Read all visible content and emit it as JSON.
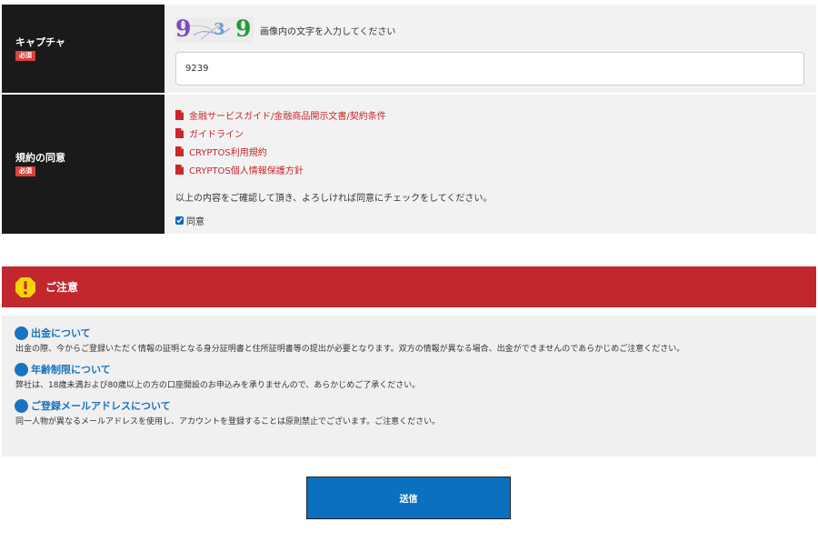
{
  "captcha": {
    "label": "キャプチャ",
    "required_badge": "必須",
    "image_chars": [
      "9",
      "3",
      "9"
    ],
    "image_colors": [
      "#7a4bbf",
      "#6f9bd1",
      "#1f9a3a"
    ],
    "hint": "画像内の文字を入力してください",
    "input_value": "9239"
  },
  "terms": {
    "label": "規約の同意",
    "required_badge": "必須",
    "documents": [
      "金融サービスガイド/金融商品開示文書/契約条件",
      "ガイドライン",
      "CRYPTOS利用規約",
      "CRYPTOS個人情報保護方針"
    ],
    "note": "以上の内容をご確認して頂き、よろしければ同意にチェックをしてください。",
    "agree_label": "同意",
    "agree_checked": true
  },
  "caution": {
    "title": "ご注意",
    "icon": "warning-icon",
    "items": [
      {
        "heading": "出金について",
        "text": "出金の際、今からご登録いただく情報の証明となる身分証明書と住所証明書等の提出が必要となります。双方の情報が異なる場合、出金ができませんのであらかじめご注意ください。"
      },
      {
        "heading": "年齢制限について",
        "text": "弊社は、18歳未満および80歳以上の方の口座開設のお申込みを承りませんので、あらかじめご了承ください。"
      },
      {
        "heading": "ご登録メールアドレスについて",
        "text": "同一人物が異なるメールアドレスを使用し、アカウントを登録することは原則禁止でございます。ご注意ください。"
      }
    ]
  },
  "submit_label": "送信",
  "colors": {
    "label_bg": "#1a1a1a",
    "badge": "#d9413c",
    "link_red": "#c8272b",
    "caution_red": "#c1272d",
    "note_blue": "#1a73c1",
    "button_blue": "#0a70bf"
  }
}
